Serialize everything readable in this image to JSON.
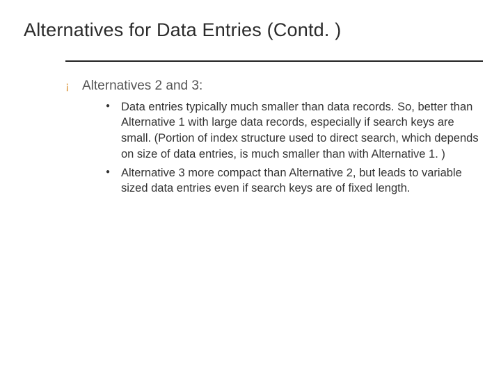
{
  "slide": {
    "title": "Alternatives for Data Entries (Contd. )",
    "lvl1_bullet_glyph": "¡",
    "lvl2_bullet_glyph": "●",
    "item1": {
      "label": "Alternatives 2 and 3:",
      "sub1": "Data entries typically much smaller than data records. So, better than Alternative 1 with large data records, especially if search keys are small. (Portion of index structure used to direct search, which depends on size of data entries, is much smaller than with Alternative 1. )",
      "sub2": "Alternative 3 more compact than Alternative 2, but leads to variable sized data entries even if search keys are of fixed length."
    }
  }
}
